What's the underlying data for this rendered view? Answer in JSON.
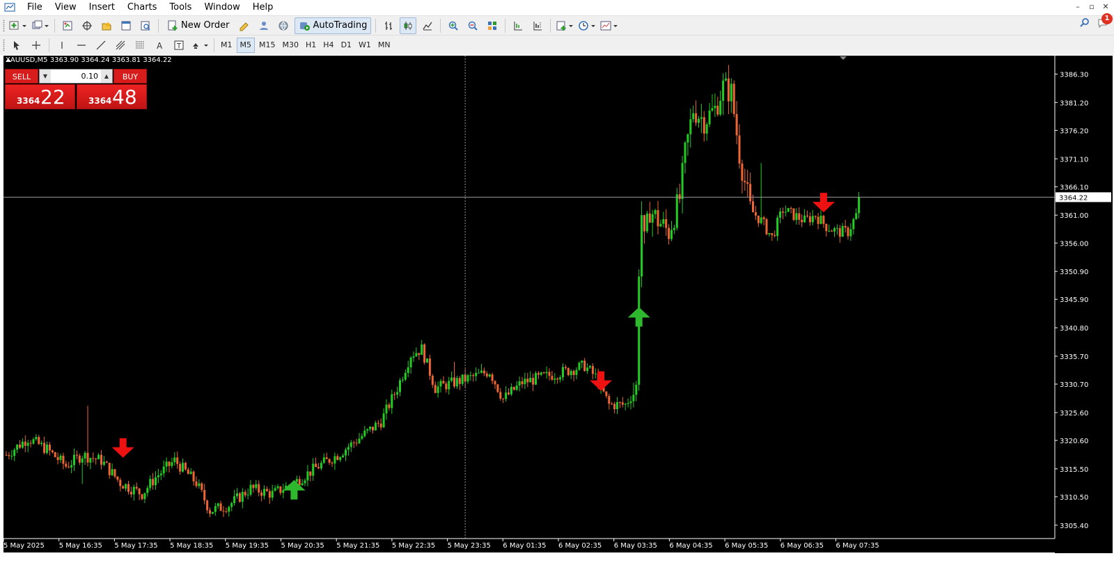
{
  "menu": [
    "File",
    "View",
    "Insert",
    "Charts",
    "Tools",
    "Window",
    "Help"
  ],
  "toolbar": {
    "new_order_label": "New Order",
    "autotrading_label": "AutoTrading",
    "notification_count": "1"
  },
  "timeframes": [
    "M1",
    "M5",
    "M15",
    "M30",
    "H1",
    "H4",
    "D1",
    "W1",
    "MN"
  ],
  "active_timeframe": "M5",
  "chart": {
    "title": "XAUUSD,M5  3363.90 3364.24 3363.81 3364.22",
    "current_price_label": "3364.22",
    "colors": {
      "background": "#000000",
      "bull": "#22cc22",
      "bear": "#ee6633",
      "signal_up": "#2eb82e",
      "signal_down": "#ee1111",
      "axis_text": "#ffffff"
    }
  },
  "trade_panel": {
    "sell_label": "SELL",
    "buy_label": "BUY",
    "lot": "0.10",
    "sell_price_small": "3364",
    "sell_price_big": "22",
    "buy_price_small": "3364",
    "buy_price_big": "48"
  },
  "chart_data": {
    "type": "candlestick",
    "symbol": "XAUUSD",
    "timeframe": "M5",
    "y_ticks": [
      "3386.30",
      "3381.20",
      "3376.20",
      "3371.10",
      "3366.10",
      "3361.00",
      "3356.00",
      "3350.90",
      "3345.90",
      "3340.80",
      "3335.70",
      "3330.70",
      "3325.60",
      "3320.60",
      "3315.50",
      "3310.50",
      "3305.40"
    ],
    "x_ticks": [
      "5 May 2025",
      "5 May 16:35",
      "5 May 17:35",
      "5 May 18:35",
      "5 May 19:35",
      "5 May 20:35",
      "5 May 21:35",
      "5 May 22:35",
      "5 May 23:35",
      "6 May 01:35",
      "6 May 02:35",
      "6 May 03:35",
      "6 May 04:35",
      "6 May 05:35",
      "6 May 06:35",
      "6 May 07:35"
    ],
    "ylim": [
      3303.0,
      3389.6
    ],
    "last_close": 3364.22,
    "anchors": [
      [
        0,
        3318
      ],
      [
        8,
        3321
      ],
      [
        15,
        3319
      ],
      [
        22,
        3316
      ],
      [
        28,
        3318
      ],
      [
        35,
        3317
      ],
      [
        42,
        3313
      ],
      [
        50,
        3311
      ],
      [
        55,
        3314
      ],
      [
        62,
        3317
      ],
      [
        70,
        3313
      ],
      [
        75,
        3308
      ],
      [
        82,
        3309
      ],
      [
        90,
        3312
      ],
      [
        98,
        3311
      ],
      [
        106,
        3313
      ],
      [
        115,
        3316
      ],
      [
        122,
        3318
      ],
      [
        130,
        3321
      ],
      [
        138,
        3324
      ],
      [
        144,
        3330
      ],
      [
        149,
        3336
      ],
      [
        153,
        3337
      ],
      [
        158,
        3330
      ],
      [
        165,
        3331
      ],
      [
        172,
        3332
      ],
      [
        178,
        3333
      ],
      [
        183,
        3328
      ],
      [
        190,
        3331
      ],
      [
        198,
        3332
      ],
      [
        206,
        3333
      ],
      [
        213,
        3334
      ],
      [
        217,
        3332
      ],
      [
        222,
        3327
      ],
      [
        228,
        3327
      ],
      [
        232,
        3330
      ],
      [
        234,
        3353
      ],
      [
        237,
        3362
      ],
      [
        240,
        3360
      ],
      [
        244,
        3358
      ],
      [
        248,
        3364
      ],
      [
        250,
        3372
      ],
      [
        253,
        3380
      ],
      [
        257,
        3378
      ],
      [
        261,
        3380
      ],
      [
        264,
        3384
      ],
      [
        267,
        3383
      ],
      [
        270,
        3372
      ],
      [
        274,
        3362
      ],
      [
        278,
        3360
      ],
      [
        282,
        3357
      ],
      [
        286,
        3362
      ],
      [
        290,
        3361
      ],
      [
        294,
        3360
      ],
      [
        298,
        3361
      ],
      [
        302,
        3359
      ],
      [
        306,
        3358
      ],
      [
        310,
        3358
      ],
      [
        313,
        3361
      ],
      [
        314,
        3364.22
      ]
    ],
    "signals": [
      {
        "type": "sell",
        "bar": 43,
        "price": 3318
      },
      {
        "type": "buy",
        "bar": 106,
        "price": 3313
      },
      {
        "type": "sell",
        "bar": 219,
        "price": 3330
      },
      {
        "type": "buy",
        "bar": 233,
        "price": 3344
      },
      {
        "type": "sell",
        "bar": 301,
        "price": 3362
      }
    ],
    "crosshair_bar": 169
  }
}
